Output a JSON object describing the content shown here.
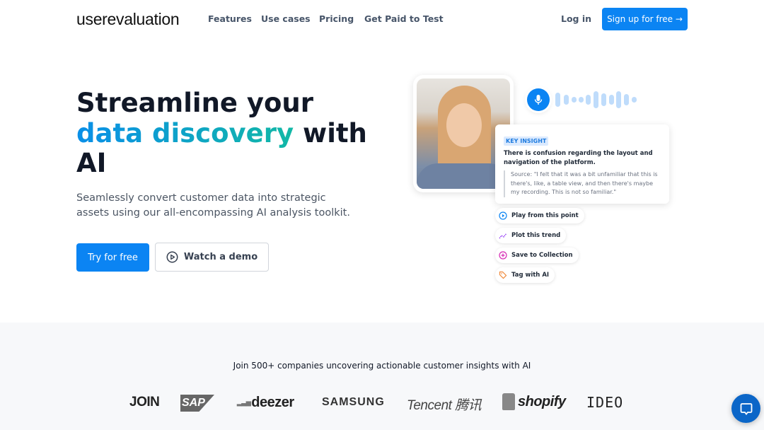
{
  "header": {
    "logo": "userevaluation",
    "nav": [
      "Features",
      "Use cases",
      "Pricing",
      "Get Paid to Test"
    ],
    "login": "Log in",
    "signup": "Sign up for free →"
  },
  "hero": {
    "title_line1": "Streamline your",
    "title_highlight": "data discovery",
    "title_rest": " with",
    "title_line3": "AI",
    "subtitle": "Seamlessly convert customer data into strategic assets using our all-encompassing AI analysis toolkit.",
    "try_label": "Try for free",
    "demo_label": "Watch a demo"
  },
  "insight": {
    "badge": "KEY INSIGHT",
    "title": "There is confusion regarding the layout and navigation of the platform.",
    "source": "Source: \"I felt that it was a bit unfamiliar that this is there's, like, a table view, and then there's maybe my recording. This is not so familiar.\""
  },
  "actions": [
    {
      "label": "Play from this point",
      "icon": "play-circle-icon",
      "color": "#0b84f3"
    },
    {
      "label": "Plot this trend",
      "icon": "sparkle-trend-icon",
      "color": "#8b2cf5"
    },
    {
      "label": "Save to Collection",
      "icon": "plus-circle-icon",
      "color": "#d62bb5"
    },
    {
      "label": "Tag with AI",
      "icon": "tag-icon",
      "color": "#f08a3c"
    }
  ],
  "social": {
    "text": "Join 500+ companies uncovering actionable customer insights with AI",
    "logos": [
      "JOIN",
      "SAP",
      "deezer",
      "SAMSUNG",
      "Tencent 腾讯",
      "shopify",
      "IDEO"
    ]
  },
  "colors": {
    "primary": "#0b84f3",
    "gray_section": "#f7f8fa",
    "chat": "#0b66c8"
  }
}
